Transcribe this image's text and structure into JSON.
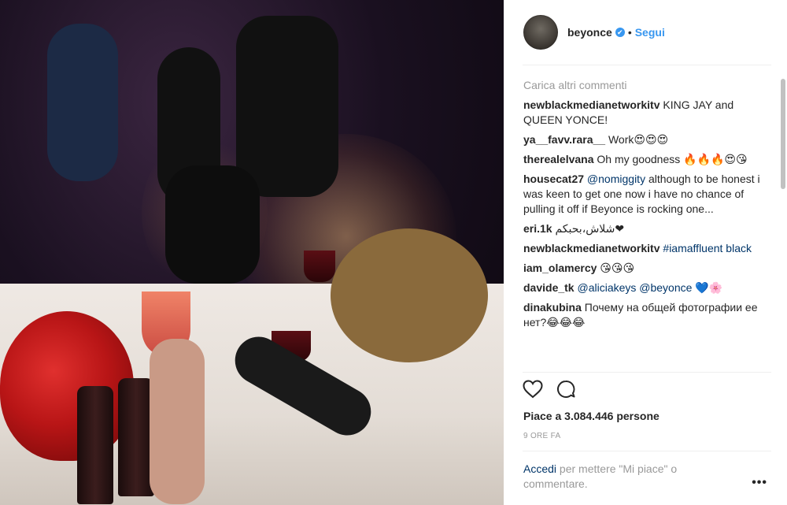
{
  "post": {
    "username": "beyonce",
    "verified_mark": "✔",
    "dot": "•",
    "follow_label": "Segui"
  },
  "comments": {
    "load_more": "Carica altri commenti",
    "items": [
      {
        "user": "newblackmedianetworkitv",
        "text": " KING JAY and QUEEN YONCE!"
      },
      {
        "user": "ya__favv.rara__",
        "text": " Work😍😍😍"
      },
      {
        "user": "therealelvana",
        "text": " Oh my goodness 🔥🔥🔥😍😘"
      },
      {
        "user": "housecat27",
        "mention": " @nomiggity",
        "text": " although to be honest i was keen to get one now i have no chance of pulling it off if Beyonce is rocking one..."
      },
      {
        "user": "eri.1k",
        "text": " شلاش،بحبكم❤"
      },
      {
        "user": "newblackmedianetworkitv",
        "mention": " #iamaffluent black",
        "text": ""
      },
      {
        "user": "iam_olamercy",
        "text": " 😘😘😘"
      },
      {
        "user": "davide_tk",
        "mention": " @aliciakeys @beyonce",
        "text": " 💙🌸"
      },
      {
        "user": "dinakubina",
        "text": " Почему на общей фотографии ее нет?😂😂😂"
      }
    ]
  },
  "actions": {
    "like_icon": "heart-outline",
    "comment_icon": "speech-bubble"
  },
  "likes_text": "Piace a 3.084.446 persone",
  "timestamp": "9 ORE FA",
  "login": {
    "link": "Accedi",
    "rest": " per mettere \"Mi piace\" o commentare."
  },
  "more_label": "•••"
}
